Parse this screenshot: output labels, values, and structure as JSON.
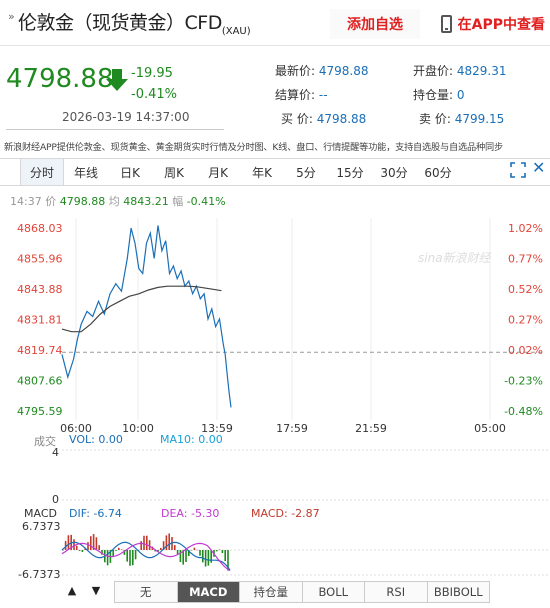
{
  "header": {
    "breadcrumb_icon": "»",
    "title": "伦敦金（现货黄金）CFD",
    "title_sub": "(XAU)",
    "add_watch": "添加自选",
    "view_app": "在APP中查看"
  },
  "quote_block": {
    "price": "4798.88",
    "change": "-19.95",
    "change_pct": "-0.41%",
    "timestamp": "2026-03-19 14:37:00",
    "direction_icon": "down-arrow-icon",
    "color_down": "#1f8a1f",
    "color_up": "#e0443a"
  },
  "info": {
    "latest_label": "最新价:",
    "latest_value": "4798.88",
    "open_label": "开盘价:",
    "open_value": "4829.31",
    "settle_label": "结算价:",
    "settle_value": "--",
    "position_label": "持仓量:",
    "position_value": "0",
    "buy_label": "买  价:",
    "buy_value": "4798.88",
    "sell_label": "卖  价:",
    "sell_value": "4799.15"
  },
  "description": "新浪财经APP提供伦敦金、现货黄金、黄金期货实时行情及分时图、K线、盘口、行情提醒等功能，支持自选股与自选品种同步",
  "tabs": [
    "分时",
    "年线",
    "日K",
    "周K",
    "月K",
    "年K",
    "5分",
    "15分",
    "30分",
    "60分"
  ],
  "active_tab": "分时",
  "realtime": {
    "time": "14:37",
    "price_label": "价",
    "price": "4798.88",
    "avg_label": "均",
    "avg": "4843.21",
    "range_label": "幅",
    "range": "-0.41%"
  },
  "watermark": "sina新浪财经",
  "chart_data": {
    "type": "line",
    "y_ticks_left": [
      "4868.03",
      "4855.96",
      "4843.88",
      "4831.81",
      "4819.74",
      "4807.66",
      "4795.59"
    ],
    "y_ticks_right": [
      "1.02%",
      "0.77%",
      "0.52%",
      "0.27%",
      "0.02%",
      "-0.23%",
      "-0.48%"
    ],
    "x_ticks": [
      "06:00",
      "10:00",
      "13:59",
      "17:59",
      "21:59",
      "05:00"
    ],
    "ylim": [
      4795.59,
      4868.03
    ],
    "baseline": 4818.83,
    "series": [
      {
        "name": "价",
        "x": [
          0,
          6,
          12,
          16,
          20,
          26,
          32,
          38,
          44,
          50,
          56,
          62,
          68,
          72,
          76,
          80,
          84,
          88,
          92,
          96,
          100,
          104,
          108,
          112,
          116,
          120,
          124,
          128,
          132,
          136,
          140,
          144,
          148,
          152,
          156,
          160,
          164,
          168,
          170,
          172,
          174,
          176
        ],
        "values": [
          4818,
          4809,
          4816,
          4824,
          4830,
          4835,
          4833,
          4839,
          4834,
          4842,
          4846,
          4843,
          4856,
          4868,
          4862,
          4852,
          4850,
          4862,
          4866,
          4856,
          4869,
          4859,
          4863,
          4850,
          4853,
          4848,
          4851,
          4845,
          4847,
          4842,
          4845,
          4840,
          4842,
          4832,
          4836,
          4829,
          4832,
          4822,
          4818,
          4810,
          4803,
          4797
        ]
      },
      {
        "name": "均",
        "x": [
          0,
          10,
          20,
          30,
          40,
          50,
          60,
          70,
          80,
          90,
          100,
          110,
          120,
          130,
          140,
          150,
          160,
          166
        ],
        "values": [
          4828,
          4827,
          4827,
          4830,
          4834,
          4837,
          4839,
          4841,
          4842,
          4843.5,
          4844.5,
          4845,
          4845,
          4845,
          4844.8,
          4844.2,
          4843.6,
          4843.2
        ]
      }
    ],
    "volume": {
      "label": "成交",
      "vol_label": "VOL:",
      "vol_value": "0.00",
      "ma_label": "MA10:",
      "ma_value": "0.00",
      "ylim": [
        0,
        4
      ]
    },
    "macd": {
      "label": "MACD",
      "dif_label": "DIF:",
      "dif_value": "-6.74",
      "dea_label": "DEA:",
      "dea_value": "-5.30",
      "macd_label": "MACD:",
      "macd_value": "-2.87",
      "ylim": [
        -6.7373,
        6.7373
      ],
      "ytick_top": "6.7373",
      "ytick_bottom": "-6.7373"
    }
  },
  "bottom_tabs": [
    "无",
    "MACD",
    "持仓量",
    "BOLL",
    "RSI",
    "BBIBOLL"
  ],
  "bottom_active": "MACD",
  "nav": {
    "up_icon": "▲",
    "down_icon": "▼"
  }
}
